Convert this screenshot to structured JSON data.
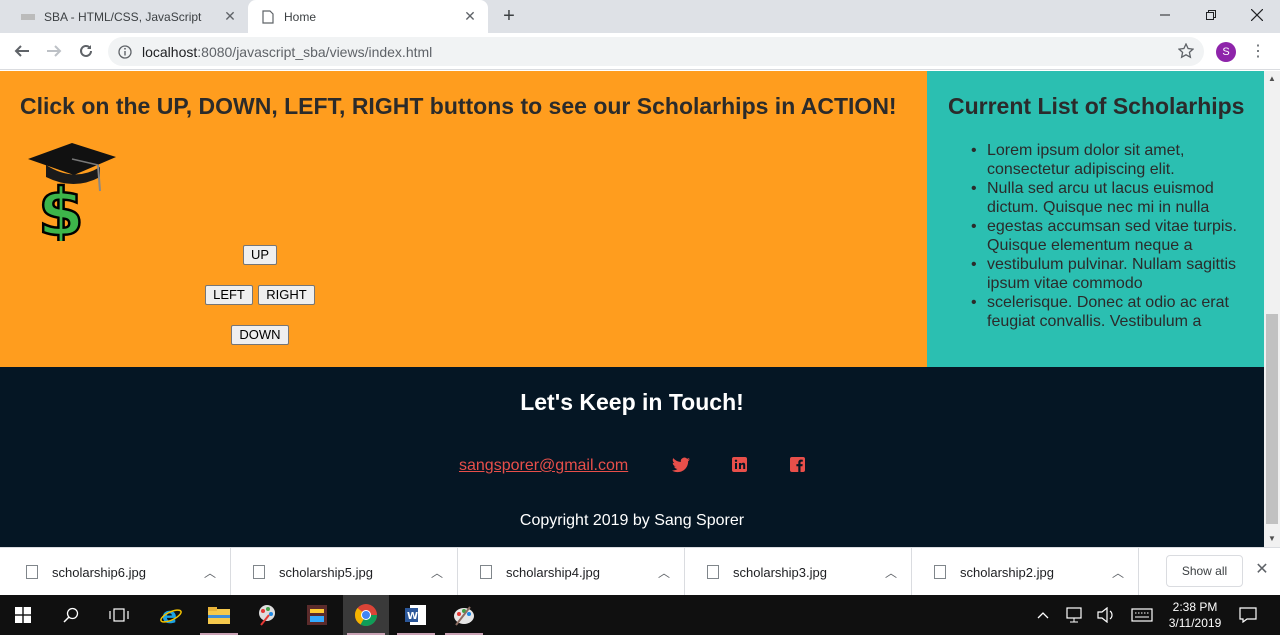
{
  "browser": {
    "tabs": [
      {
        "title": "SBA - HTML/CSS, JavaScript",
        "active": false
      },
      {
        "title": "Home",
        "active": true
      }
    ],
    "new_tab_label": "+",
    "address": {
      "host": "localhost",
      "path": ":8080/javascript_sba/views/index.html"
    },
    "profile_initial": "S",
    "colors": {
      "tabstrip": "#dee1e6",
      "profile": "#8e24aa"
    }
  },
  "page": {
    "heading": "Click on the UP, DOWN, LEFT, RIGHT buttons to see our Scholarhips in ACTION!",
    "mascot_icon": "graduation-cap-dollar-icon",
    "controls": {
      "up": "UP",
      "left": "LEFT",
      "right": "RIGHT",
      "down": "DOWN"
    },
    "sidebar": {
      "title": "Current List of Scholarhips",
      "items": [
        "Lorem ipsum dolor sit amet, consectetur adipiscing elit.",
        "Nulla sed arcu ut lacus euismod dictum. Quisque nec mi in nulla",
        "egestas accumsan sed vitae turpis. Quisque elementum neque a",
        "vestibulum pulvinar. Nullam sagittis ipsum vitae commodo",
        "scelerisque. Donec at odio ac erat feugiat convallis. Vestibulum a"
      ]
    },
    "footer": {
      "title": "Let's Keep in Touch!",
      "email": "sangsporer@gmail.com",
      "social_icons": [
        "twitter-icon",
        "linkedin-icon",
        "facebook-icon"
      ],
      "copyright": "Copyright 2019 by Sang Sporer"
    },
    "colors": {
      "main_bg": "#ff9d1e",
      "sidebar_bg": "#2bbfb1",
      "footer_bg": "#051624",
      "link": "#e84f4a"
    }
  },
  "downloads": {
    "items": [
      "scholarship6.jpg",
      "scholarship5.jpg",
      "scholarship4.jpg",
      "scholarship3.jpg",
      "scholarship2.jpg"
    ],
    "show_all": "Show all"
  },
  "taskbar": {
    "time": "2:38 PM",
    "date": "3/11/2019"
  }
}
